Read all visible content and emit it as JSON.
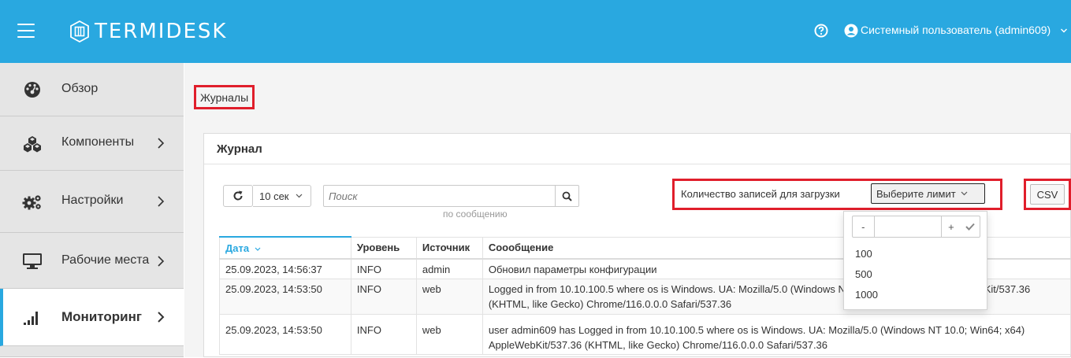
{
  "app": {
    "brand": "TERMIDESK",
    "accent": "#29a8e0",
    "highlight": "#e01e2b"
  },
  "header": {
    "user_label": "Системный пользователь (admin609)"
  },
  "sidebar": {
    "items": [
      {
        "label": "Обзор",
        "icon": "dashboard-icon"
      },
      {
        "label": "Компоненты",
        "icon": "cubes-icon"
      },
      {
        "label": "Настройки",
        "icon": "gears-icon"
      },
      {
        "label": "Рабочие места",
        "icon": "desktop-icon"
      },
      {
        "label": "Мониторинг",
        "icon": "signal-bars-icon"
      }
    ]
  },
  "breadcrumb": "Журналы",
  "panel": {
    "title": "Журнал"
  },
  "toolbar": {
    "interval": "10 сек",
    "search_placeholder": "Поиск",
    "search_hint": "по сообщению",
    "limit_label": "Количество записей для загрузки",
    "limit_select": "Выберите лимит",
    "csv_label": "CSV"
  },
  "limit_dropdown": {
    "options": [
      "100",
      "500",
      "1000"
    ],
    "minus": "-",
    "plus": "+"
  },
  "table": {
    "columns": [
      "Дата",
      "Уровень",
      "Источник",
      "Соообщение"
    ],
    "rows": [
      [
        "25.09.2023, 14:56:37",
        "INFO",
        "admin",
        "Обновил параметры конфигурации"
      ],
      [
        "25.09.2023, 14:53:50",
        "INFO",
        "web",
        "Logged in from 10.10.100.5 where os is Windows. UA: Mozilla/5.0 (Windows NT 10.0; Win64; x64) AppleWebKit/537.36 (KHTML, like Gecko) Chrome/116.0.0.0 Safari/537.36"
      ],
      [
        "25.09.2023, 14:53:50",
        "INFO",
        "web",
        "user admin609 has Logged in from 10.10.100.5 where os is Windows. UA: Mozilla/5.0 (Windows NT 10.0; Win64; x64) AppleWebKit/537.36 (KHTML, like Gecko) Chrome/116.0.0.0 Safari/537.36"
      ]
    ]
  }
}
